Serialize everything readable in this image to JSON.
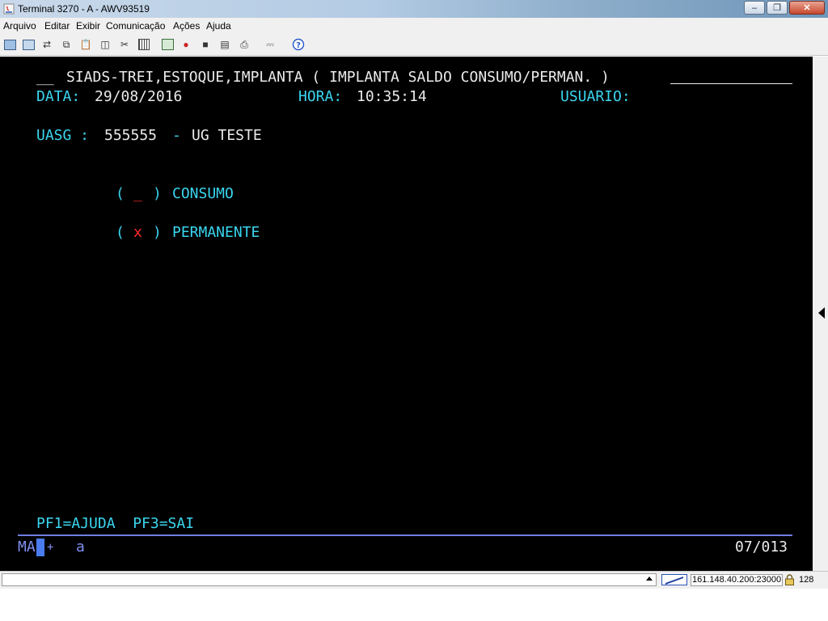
{
  "window": {
    "title": "Terminal 3270 - A - AWV93519"
  },
  "menu": [
    {
      "label": "Arquivo"
    },
    {
      "label": "Editar"
    },
    {
      "label": "Exibir"
    },
    {
      "label": "Comunicação"
    },
    {
      "label": "Ações"
    },
    {
      "label": "Ajuda"
    }
  ],
  "toolbar": {
    "icons": [
      "new-session-icon",
      "open-session-icon",
      "send-file-icon",
      "copy-icon",
      "paste-icon",
      "clipboard-icon",
      "cut-icon",
      "keypad-icon",
      "macro-play-icon",
      "macro-record-icon",
      "disconnect-icon",
      "print-icon",
      "print-screen-icon",
      "printer-icon",
      "help-icon"
    ]
  },
  "terminal": {
    "header_prefix": "__",
    "header_title": "SIADS-TREI,ESTOQUE,IMPLANTA ( IMPLANTA SALDO CONSUMO/PERMAN. )",
    "data_label": "DATA:",
    "data_value": "29/08/2016",
    "hora_label": "HORA:",
    "hora_value": "10:35:14",
    "usuario_label": "USUARIO:",
    "uasg_label": "UASG :",
    "uasg_value": "555555",
    "uasg_separator": "-",
    "uasg_name": "UG TESTE",
    "options": [
      {
        "open": "(",
        "value": "_",
        "close": ")",
        "label": "CONSUMO"
      },
      {
        "open": "(",
        "value": "x",
        "close": ")",
        "label": "PERMANENTE"
      }
    ],
    "pf_keys": "PF1=AJUDA  PF3=SAI",
    "oia": {
      "mode": "MA",
      "indicator": "+",
      "input_mode": "a",
      "cursor_position": "07/013"
    }
  },
  "statusbar": {
    "host": "161.148.40.200:23000",
    "encryption_bits": "128"
  },
  "colors": {
    "terminal_bg": "#000000",
    "field_label": "#3ad6f0",
    "field_value": "#ebebeb",
    "selected_mark": "#ff2a2a",
    "oia_line": "#6f7fe0"
  }
}
